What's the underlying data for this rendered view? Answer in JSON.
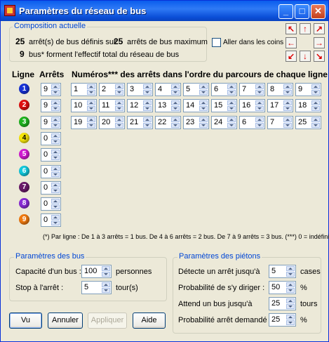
{
  "window": {
    "title": "Paramètres du réseau de bus"
  },
  "composition": {
    "title": "Composition actuelle",
    "defined_count": "25",
    "defined_text": "arrêt(s) de bus définis sur",
    "max_count": "25",
    "max_text": "arrêts de bus maximum",
    "bus_count": "9",
    "bus_text": "bus* forment l'effectif total du réseau de bus"
  },
  "corners": {
    "label": "Aller dans les coins",
    "checked": false
  },
  "direction_icons": [
    "arrow-up-left",
    "arrow-up",
    "arrow-up-right",
    "arrow-left",
    "arrow-right",
    "arrow-down-left",
    "arrow-down",
    "arrow-down-right"
  ],
  "headers": {
    "line": "Ligne",
    "stops": "Arrêts",
    "numbers": "Numéros*** des arrêts dans l'ordre du parcours de chaque ligne"
  },
  "lines": [
    {
      "num": "1",
      "color": "#1833d6",
      "stops": "9",
      "sequence": [
        "1",
        "2",
        "3",
        "4",
        "5",
        "6",
        "7",
        "8",
        "9"
      ]
    },
    {
      "num": "2",
      "color": "#e01010",
      "stops": "9",
      "sequence": [
        "10",
        "11",
        "12",
        "13",
        "14",
        "15",
        "16",
        "17",
        "18"
      ]
    },
    {
      "num": "3",
      "color": "#1fb41f",
      "stops": "9",
      "sequence": [
        "19",
        "20",
        "21",
        "22",
        "23",
        "24",
        "6",
        "7",
        "25"
      ]
    },
    {
      "num": "4",
      "color": "#f5e50a",
      "stops": "0",
      "sequence": []
    },
    {
      "num": "5",
      "color": "#d21ad2",
      "stops": "0",
      "sequence": []
    },
    {
      "num": "6",
      "color": "#12c8dc",
      "stops": "0",
      "sequence": []
    },
    {
      "num": "7",
      "color": "#6a1a6a",
      "stops": "0",
      "sequence": []
    },
    {
      "num": "8",
      "color": "#8a2ad6",
      "stops": "0",
      "sequence": []
    },
    {
      "num": "9",
      "color": "#f07a10",
      "stops": "0",
      "sequence": []
    }
  ],
  "footnote": "(*) Par ligne : De 1 à 3 arrêts = 1 bus. De 4 à 6 arrêts = 2 bus. De 7 à 9 arrêts = 3 bus.   (***) 0 = indéfini",
  "bus_params": {
    "title": "Paramètres des bus",
    "capacity_label": "Capacité d'un bus :",
    "capacity_value": "100",
    "capacity_unit": "personnes",
    "stop_label": "Stop à l'arrêt :",
    "stop_value": "5",
    "stop_unit": "tour(s)"
  },
  "ped_params": {
    "title": "Paramètres des piétons",
    "detect_label": "Détecte un arrêt jusqu'à",
    "detect_value": "5",
    "detect_unit": "cases",
    "prob_label": "Probabilité de s'y diriger :",
    "prob_value": "50",
    "prob_unit": "%",
    "wait_label": "Attend un bus jusqu'à",
    "wait_value": "25",
    "wait_unit": "tours",
    "req_label": "Probabilité arrêt demandé :",
    "req_value": "25",
    "req_unit": "%"
  },
  "buttons": {
    "ok": "Vu",
    "cancel": "Annuler",
    "apply": "Appliquer",
    "help": "Aide"
  }
}
